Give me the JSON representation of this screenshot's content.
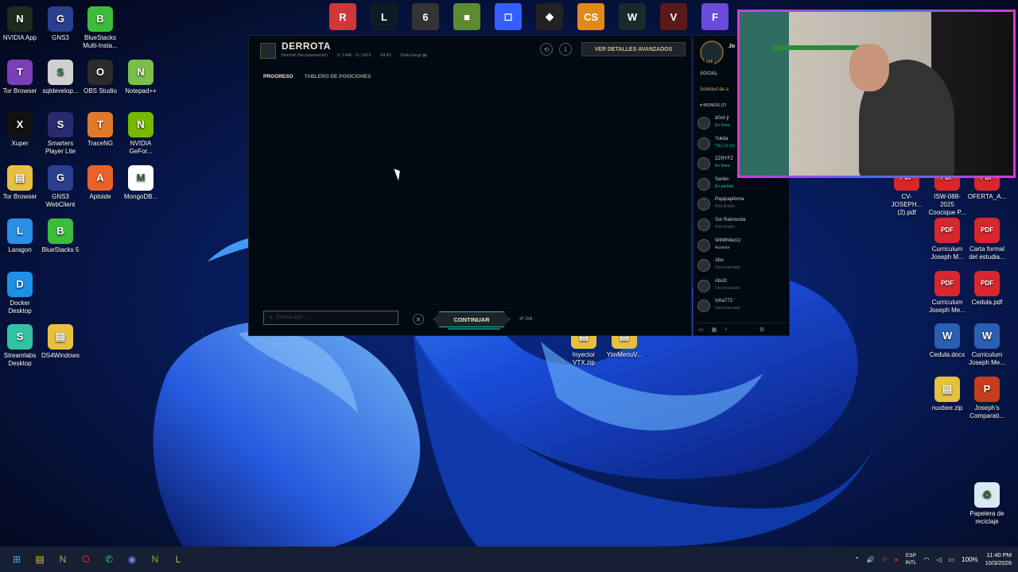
{
  "desktop": {
    "left_icons": [
      {
        "label": "NVIDIA App",
        "glyph": "N",
        "color": "#1f2a1f"
      },
      {
        "label": "GNS3",
        "glyph": "G",
        "color": "#2a3f8f"
      },
      {
        "label": "BlueStacks Multi-Insta...",
        "glyph": "B",
        "color": "#3bbd3b"
      },
      {
        "label": "Tor Browser",
        "glyph": "T",
        "color": "#7a3fb5"
      },
      {
        "label": "sqldevelop...",
        "glyph": "S",
        "color": "#d0d0d0"
      },
      {
        "label": "OBS Studio",
        "glyph": "O",
        "color": "#2b2b2b"
      },
      {
        "label": "Notepad++",
        "glyph": "N",
        "color": "#7bbf4a"
      },
      {
        "label": "Xuper",
        "glyph": "X",
        "color": "#111111"
      },
      {
        "label": "Smarters Player Lite",
        "glyph": "S",
        "color": "#2a2a6f"
      },
      {
        "label": "TraceNG",
        "glyph": "T",
        "color": "#e07a2a"
      },
      {
        "label": "NVIDIA GeFor...",
        "glyph": "N",
        "color": "#76b900"
      },
      {
        "label": "Tor Browser",
        "glyph": "▤",
        "color": "#e8c040"
      },
      {
        "label": "GNS3 WebClient",
        "glyph": "G",
        "color": "#2a3f8f"
      },
      {
        "label": "Aptoide",
        "glyph": "A",
        "color": "#e8632a"
      },
      {
        "label": "MongoDB...",
        "glyph": "M",
        "color": "#ffffff"
      },
      {
        "label": "Laragon",
        "glyph": "L",
        "color": "#2a8fe8"
      },
      {
        "label": "BlueStacks 5",
        "glyph": "B",
        "color": "#3bbd3b"
      },
      {
        "label": "Docker Desktop",
        "glyph": "D",
        "color": "#1d91e6"
      },
      {
        "label": "Streamlabs Desktop",
        "glyph": "S",
        "color": "#31c3a2"
      },
      {
        "label": "DS4Windows",
        "glyph": "▤",
        "color": "#e8c040"
      }
    ],
    "right_icons": [
      {
        "label": "CV-JOSEPH... (2).pdf",
        "glyph": "PDF",
        "color": "#d8262c"
      },
      {
        "label": "ISW-088-2025 Coocique P...",
        "glyph": "PDF",
        "color": "#d8262c"
      },
      {
        "label": "OFERTA_A...",
        "glyph": "PDF",
        "color": "#d8262c"
      },
      {
        "label": "Curriculum Joseph M...",
        "glyph": "PDF",
        "color": "#d8262c"
      },
      {
        "label": "Carta formal del estudia...",
        "glyph": "PDF",
        "color": "#d8262c"
      },
      {
        "label": "Curriculum Joseph Me...",
        "glyph": "PDF",
        "color": "#d8262c"
      },
      {
        "label": "Cedula.pdf",
        "glyph": "PDF",
        "color": "#d8262c"
      },
      {
        "label": "Cedula.docx",
        "glyph": "W",
        "color": "#2b5fb4"
      },
      {
        "label": "Curriculum Joseph Me...",
        "glyph": "W",
        "color": "#2b5fb4"
      },
      {
        "label": "nuxbee.zip",
        "glyph": "▤",
        "color": "#e8c040"
      },
      {
        "label": "Joseph's Comparati...",
        "glyph": "P",
        "color": "#c43e1c"
      },
      {
        "label": "Papelera de reciclaje",
        "glyph": "♻",
        "color": "#d9e8f2"
      }
    ],
    "middle_icons": [
      {
        "label": "Inyector VTX.zip",
        "glyph": "▤",
        "color": "#e8c040"
      },
      {
        "label": "YimMenuV...",
        "glyph": "▤",
        "color": "#e8c040"
      }
    ],
    "top_strip": [
      {
        "name": "riot-icon",
        "glyph": "R",
        "color": "#d13639"
      },
      {
        "name": "league-icon",
        "glyph": "L",
        "color": "#0f1a24"
      },
      {
        "name": "rainbow-six-icon",
        "glyph": "6",
        "color": "#333333"
      },
      {
        "name": "minecraft-icon",
        "glyph": "■",
        "color": "#5b8a32"
      },
      {
        "name": "roblox-studio-icon",
        "glyph": "◻",
        "color": "#335fff"
      },
      {
        "name": "roblox-icon",
        "glyph": "◆",
        "color": "#222222"
      },
      {
        "name": "counter-strike-icon",
        "glyph": "CS",
        "color": "#e08a1e"
      },
      {
        "name": "wuthering-icon",
        "glyph": "W",
        "color": "#1a2a2a"
      },
      {
        "name": "game-icon",
        "glyph": "V",
        "color": "#5a1a1a"
      },
      {
        "name": "fall-guys-icon",
        "glyph": "F",
        "color": "#6a4bd8"
      }
    ]
  },
  "client": {
    "title": "DERROTA",
    "meta": [
      "Normal (Reclutamiento)",
      "V: 1446 · D: 1419",
      "34:43",
      "IDdeJuego ▤"
    ],
    "advanced_button": "VER DETALLES AVANZADOS",
    "tabs": [
      "PROGRESO",
      "TABLERO DE POSICIONES"
    ],
    "chat_placeholder": "Escribe aquí...",
    "continue_label": "CONTINUAR",
    "vote_count": "0/4"
  },
  "social": {
    "summoner": "Jo",
    "level": "608",
    "section_label": "SOCIAL",
    "request_label": "Solicitud de a",
    "group_label": "▾ MONOS (7/",
    "friends": [
      {
        "name": "d0s0 jr",
        "status": "En línea",
        "status_color": "#0acf83"
      },
      {
        "name": "Yukita",
        "status": "\"SE LO QU",
        "status_color": "#0acf83"
      },
      {
        "name": "ZZRYFZ",
        "status": "En línea",
        "status_color": "#0acf83"
      },
      {
        "name": "Sanko",
        "status": "En partida",
        "status_color": "#0acf83"
      },
      {
        "name": "Papipapiloma",
        "status": "Riot Mobile",
        "status_color": "#5b6b6a"
      },
      {
        "name": "Sor Raimunda",
        "status": "Riot Mobile",
        "status_color": "#5b6b6a"
      },
      {
        "name": "WilWhitezzz",
        "status": "Ausente",
        "status_color": "#a0b4c8"
      },
      {
        "name": "Abo",
        "status": "Desconectado",
        "status_color": "#5b6b6a"
      },
      {
        "name": "Abol1",
        "status": "Desconectado",
        "status_color": "#5b6b6a"
      },
      {
        "name": "Infra772",
        "status": "Desconectado",
        "status_color": "#5b6b6a"
      }
    ]
  },
  "taskbar": {
    "icons": [
      {
        "name": "start-icon",
        "glyph": "⊞",
        "color": "#4aa8ff"
      },
      {
        "name": "file-explorer-icon",
        "glyph": "▤",
        "color": "#e8c040"
      },
      {
        "name": "notepad-plus-icon",
        "glyph": "N",
        "color": "#7bbf4a"
      },
      {
        "name": "opera-icon",
        "glyph": "O",
        "color": "#e8262c"
      },
      {
        "name": "whatsapp-icon",
        "glyph": "✆",
        "color": "#25d366"
      },
      {
        "name": "discord-icon",
        "glyph": "◉",
        "color": "#7289da"
      },
      {
        "name": "nvidia-icon",
        "glyph": "N",
        "color": "#76b900"
      },
      {
        "name": "league-client-icon",
        "glyph": "L",
        "color": "#c8aa6e"
      }
    ],
    "language": "ESP",
    "layout": "INTL",
    "battery": "100%",
    "time": "11:40 PM",
    "date": "10/3/2026"
  }
}
